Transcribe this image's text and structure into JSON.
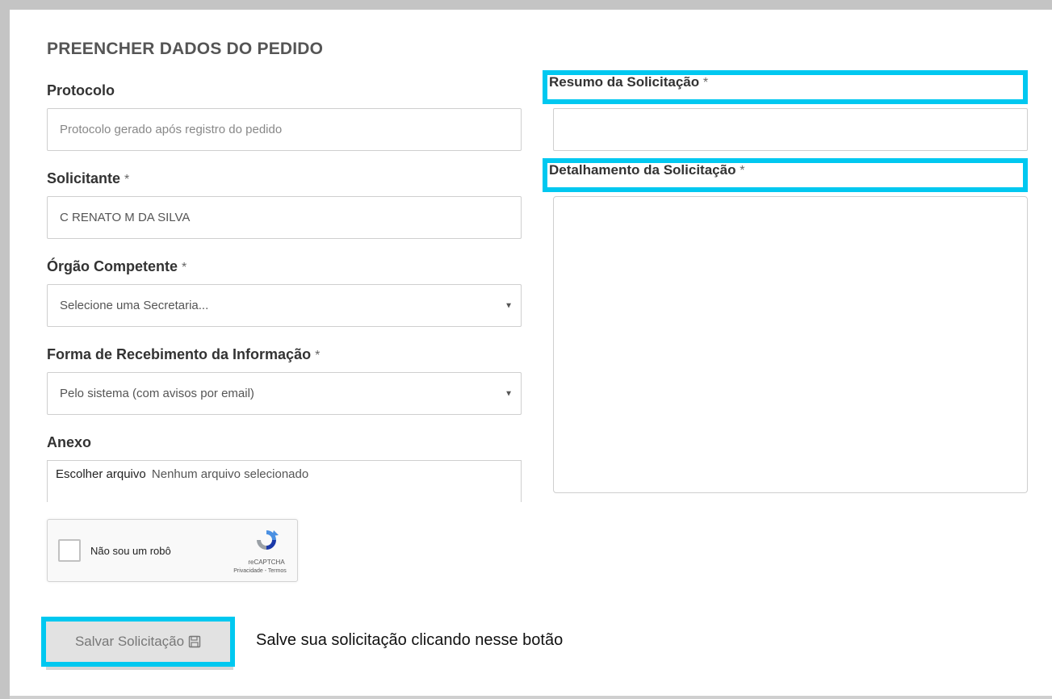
{
  "heading": "PREENCHER DADOS DO PEDIDO",
  "protocolo": {
    "label": "Protocolo",
    "placeholder": "Protocolo gerado após registro do pedido"
  },
  "solicitante": {
    "label": "Solicitante",
    "value": "C RENATO M DA SILVA"
  },
  "orgao": {
    "label": "Órgão Competente",
    "selected": "Selecione uma Secretaria..."
  },
  "forma": {
    "label": "Forma de Recebimento da Informação",
    "selected": "Pelo sistema (com avisos por email)"
  },
  "anexo": {
    "label": "Anexo",
    "button": "Escolher arquivo",
    "status": "Nenhum arquivo selecionado"
  },
  "resumo": {
    "label": "Resumo da Solicitação"
  },
  "detalhamento": {
    "label": "Detalhamento da Solicitação"
  },
  "required_mark": "*",
  "captcha": {
    "label": "Não sou um robô",
    "brand": "reCAPTCHA",
    "legal": "Privacidade - Termos"
  },
  "save": {
    "label": "Salvar Solicitação",
    "hint": "Salve sua solicitação clicando nesse botão"
  },
  "colors": {
    "highlight": "#00c8f0"
  }
}
